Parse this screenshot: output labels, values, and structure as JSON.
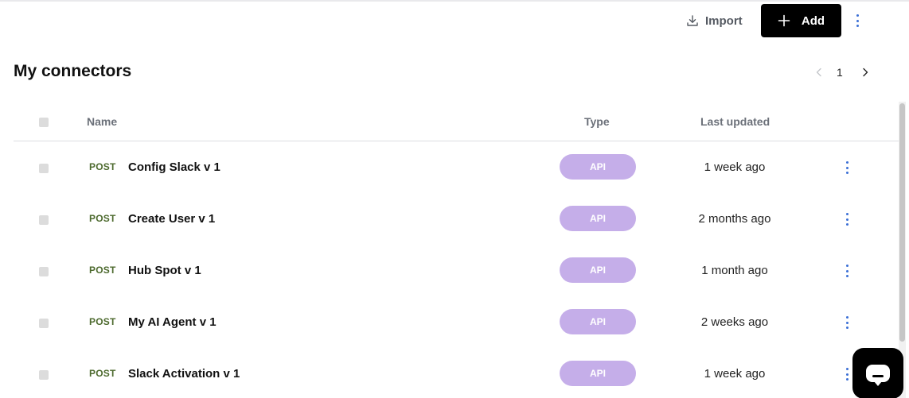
{
  "toolbar": {
    "import_label": "Import",
    "add_label": "Add"
  },
  "page": {
    "title": "My connectors"
  },
  "pagination": {
    "current_page": "1"
  },
  "table": {
    "headers": {
      "name": "Name",
      "type": "Type",
      "last_updated": "Last updated"
    },
    "rows": [
      {
        "method": "POST",
        "name": "Config Slack v 1",
        "type": "API",
        "updated": "1 week ago"
      },
      {
        "method": "POST",
        "name": "Create User v 1",
        "type": "API",
        "updated": "2 months ago"
      },
      {
        "method": "POST",
        "name": "Hub Spot v 1",
        "type": "API",
        "updated": "1 month ago"
      },
      {
        "method": "POST",
        "name": "My AI Agent v 1",
        "type": "API",
        "updated": "2 weeks ago"
      },
      {
        "method": "POST",
        "name": "Slack Activation v 1",
        "type": "API",
        "updated": "1 week ago"
      }
    ]
  },
  "colors": {
    "accent_button": "#000000",
    "type_pill": "#c5aee9",
    "method_text": "#4d6a2e",
    "kebab_dots": "#3b6fd6"
  },
  "icons": {
    "import": "download-icon",
    "add": "plus-icon",
    "more": "more-vertical-icon",
    "prev": "chevron-left-icon",
    "next": "chevron-right-icon",
    "chat": "chat-bubble-icon"
  }
}
